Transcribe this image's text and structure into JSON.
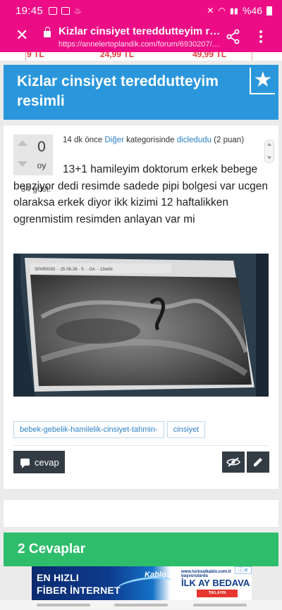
{
  "status_bar": {
    "time": "19:45",
    "battery": "%46"
  },
  "browser": {
    "close_icon": "close-icon",
    "title": "Kizlar cinsiyet tereddutteyim resi…",
    "url": "https://annelertoplandik.com/forum/6930207/…",
    "share_icon": "share-icon",
    "menu_icon": "more-vert-icon"
  },
  "promo": {
    "price_1": "9 TL",
    "price_2": "24,99 TL",
    "price_3": "49,99 TL"
  },
  "question": {
    "title": "Kizlar cinsiyet tereddutteyim resimli",
    "favorite_icon": "star-icon",
    "votes": "0",
    "vote_label": "oy",
    "views": "34 göst.",
    "meta": {
      "time": "14 dk önce",
      "category": "Diğer",
      "category_suffix": "kategorisinde",
      "user": "dicledudu",
      "points": "(2 puan)"
    },
    "body": "13+1 hamileyim doktorum erkek bebege benziyor dedi resimde sadede pipi bolgesi var ucgen olaraksa erkek diyor ikk kizimi 12 haftalikken ogrenmistim resimden anlayan var mi",
    "tags": [
      "bebek-gebelik-hamilelik-cinsiyet-tahmin-",
      "cinsiyet"
    ],
    "reply_label": "cevap"
  },
  "answers": {
    "title": "2 Cevaplar"
  },
  "ad": {
    "line1": "EN HIZLI",
    "line2": "FİBER İNTERNET",
    "brand": "Kablo",
    "small_text": "www.turksatkablo.com.tr başvurularda",
    "headline": "İLK AY BEDAVA",
    "cta": "TIKLAYIN"
  },
  "colors": {
    "brand_pink": "#ec0d86",
    "title_blue": "#2a97dc",
    "answers_green": "#2ebd6b",
    "button_dark": "#333b44",
    "link_blue": "#2a7fc9"
  }
}
